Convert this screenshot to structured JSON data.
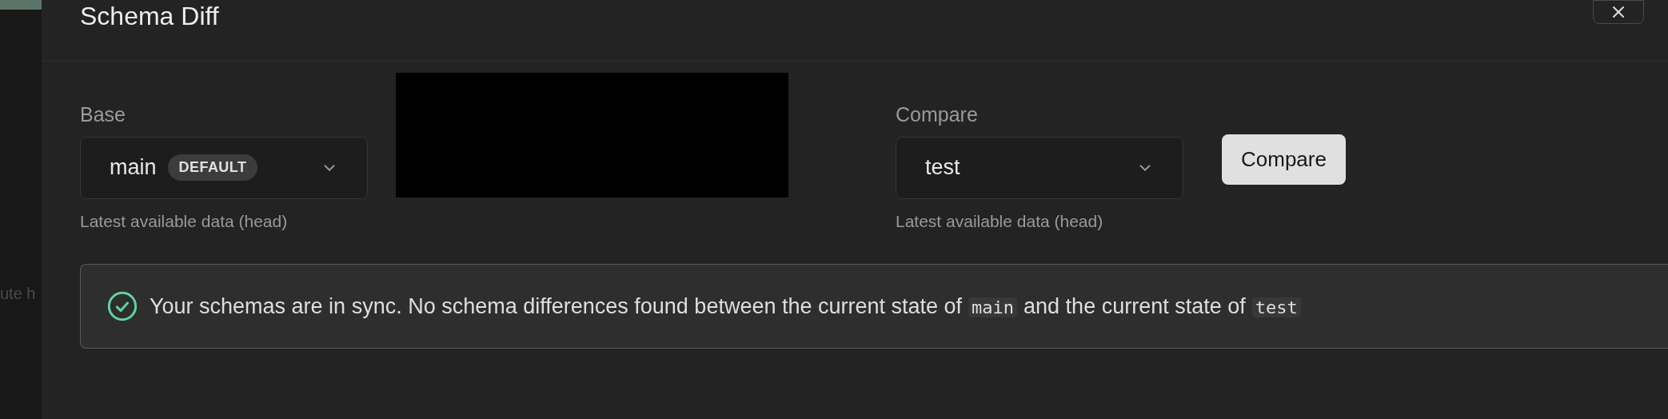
{
  "backdrop": {
    "text": "ute h"
  },
  "dialog": {
    "title": "Schema Diff"
  },
  "selectors": [
    {
      "label": "Base",
      "value": "main",
      "badge": "DEFAULT",
      "hint": "Latest available data (head)"
    },
    {
      "kind": "redacted"
    },
    {
      "label": "Compare",
      "value": "test",
      "hint": "Latest available data (head)"
    }
  ],
  "compare_button": "Compare",
  "alert": {
    "kind": "success",
    "message": [
      {
        "kind": "text",
        "text": "Your schemas are in sync. No schema differences found between the current state of"
      },
      {
        "kind": "code",
        "text": "main"
      },
      {
        "kind": "text",
        "text": "and the current state of"
      },
      {
        "kind": "code",
        "text": "test"
      }
    ]
  }
}
